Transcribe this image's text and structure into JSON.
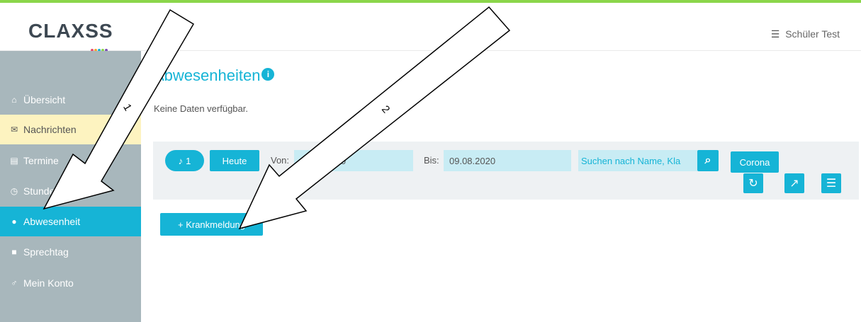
{
  "header": {
    "logo_text": "CLAXSS",
    "user_label": "Schüler Test",
    "burger_icon": "menu-icon"
  },
  "sidebar": {
    "items": [
      {
        "label": "Übersicht",
        "icon": "home-icon",
        "glyph": "⌂"
      },
      {
        "label": "Nachrichten",
        "icon": "mail-icon",
        "glyph": "✉"
      },
      {
        "label": "Termine",
        "icon": "calendar-icon",
        "glyph": "▤"
      },
      {
        "label": "Stunden",
        "icon": "clock-icon",
        "glyph": "◷"
      },
      {
        "label": "Abwesenheit",
        "icon": "absence-icon",
        "glyph": "●"
      },
      {
        "label": "Sprechtag",
        "icon": "chat-icon",
        "glyph": "■"
      },
      {
        "label": "Mein Konto",
        "icon": "user-icon",
        "glyph": "♂"
      }
    ]
  },
  "main": {
    "title": "Abwesenheiten",
    "info_glyph": "i",
    "no_data": "Keine Daten verfügbar.",
    "filter": {
      "count": "1",
      "bell_glyph": "♪",
      "today_label": "Heute",
      "from_label": "Von:",
      "from_value": "09.08.2020",
      "to_label": "Bis:",
      "to_value": "09.08.2020",
      "search_placeholder": "Suchen nach Name, Kla",
      "search_glyph": "⌕",
      "corona_label": "Corona",
      "refresh_glyph": "↻",
      "chart_glyph": "↗",
      "list_glyph": "☰"
    },
    "sick_button_label": "+ Krankmeldung"
  },
  "annotations": {
    "arrow1_label": "1",
    "arrow2_label": "2"
  },
  "colors": {
    "accent": "#16b4d6",
    "sidebar": "#a8b7bc",
    "highlight": "#fdf3c0",
    "top_stripe": "#8bd64a"
  }
}
